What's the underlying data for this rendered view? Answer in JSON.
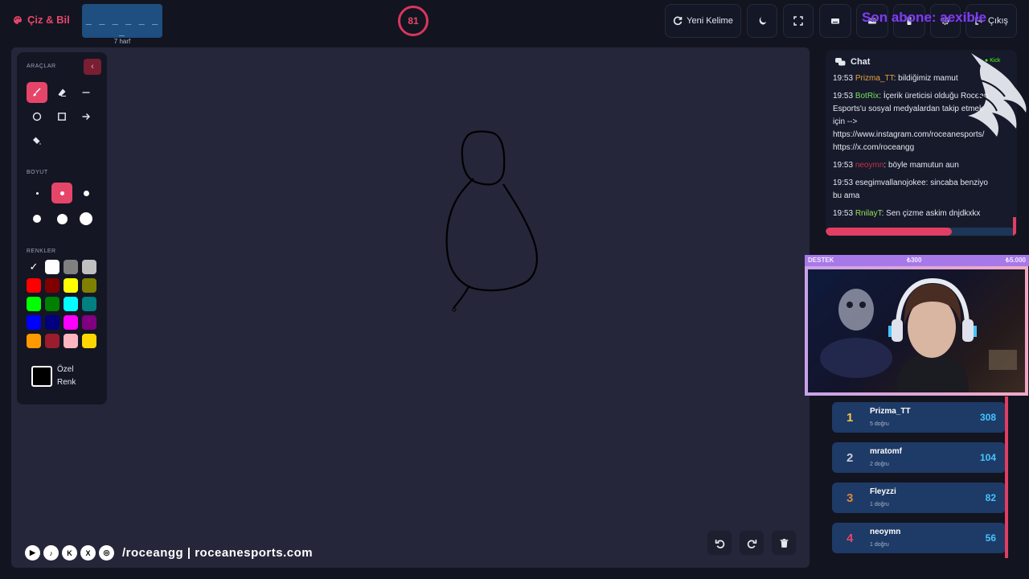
{
  "header": {
    "logo_text": "Çiz & Bil",
    "word_mask": "_ _ _ _ _ _ _",
    "letter_count": "7 harf",
    "timer": "81",
    "new_word_label": "Yeni Kelime",
    "subscriber_banner": "Son abone: aexible",
    "exit_label": "Çıkış"
  },
  "tools_panel": {
    "tools_title": "ARAÇLAR",
    "size_title": "BOYUT",
    "colors_title": "RENKLER",
    "custom_color_label": "Özel Renk",
    "colors": [
      "#000000",
      "#ffffff",
      "#808080",
      "#c0c0c0",
      "#ff0000",
      "#800000",
      "#ffff00",
      "#808000",
      "#00ff00",
      "#008000",
      "#00ffff",
      "#008080",
      "#0000ff",
      "#000080",
      "#ff00ff",
      "#800080",
      "#ff9900",
      "#9b1c2c",
      "#ffb6c1",
      "#ffd700"
    ]
  },
  "footer": {
    "handle": "/roceangg | roceanesports.com"
  },
  "chat": {
    "title": "Chat",
    "platform": "Kick",
    "progress": 0.67,
    "messages": [
      {
        "time": "19:53",
        "user": "Prizma_TT",
        "color": "#e8a33d",
        "text": ": bildiğimiz mamut"
      },
      {
        "time": "19:53",
        "user": "BotRix",
        "color": "#76e05a",
        "text": ": İçerik üreticisi olduğu Rocean Esports'u sosyal medyalardan takip etmek için --> https://www.instagram.com/roceanesports/ https://x.com/roceangg"
      },
      {
        "time": "19:53",
        "user": "neoymn",
        "color": "#c8304e",
        "text": ": böyle mamutun aun"
      },
      {
        "time": "19:53",
        "user": "esegimvallanojokee",
        "color": "#e6e8f0",
        "text": ": sincaba benziyo bu ama"
      },
      {
        "time": "19:53",
        "user": "RnilayT",
        "color": "#9be15a",
        "text": ": Sen çizme askim dnjdkxkx"
      }
    ]
  },
  "donation_bar": {
    "label": "DESTEK",
    "mid": "₺300",
    "max": "₺5.000"
  },
  "leaderboard": [
    {
      "rank": "1",
      "name": "Prizma_TT",
      "sub": "5 doğru",
      "score": "308",
      "rank_color": "#f5c842"
    },
    {
      "rank": "2",
      "name": "mratomf",
      "sub": "2 doğru",
      "score": "104",
      "rank_color": "#c7ccd6"
    },
    {
      "rank": "3",
      "name": "Fleyzzi",
      "sub": "1 doğru",
      "score": "82",
      "rank_color": "#d9873a"
    },
    {
      "rank": "4",
      "name": "neoymn",
      "sub": "1 doğru",
      "score": "56",
      "rank_color": "#e6456a"
    }
  ]
}
